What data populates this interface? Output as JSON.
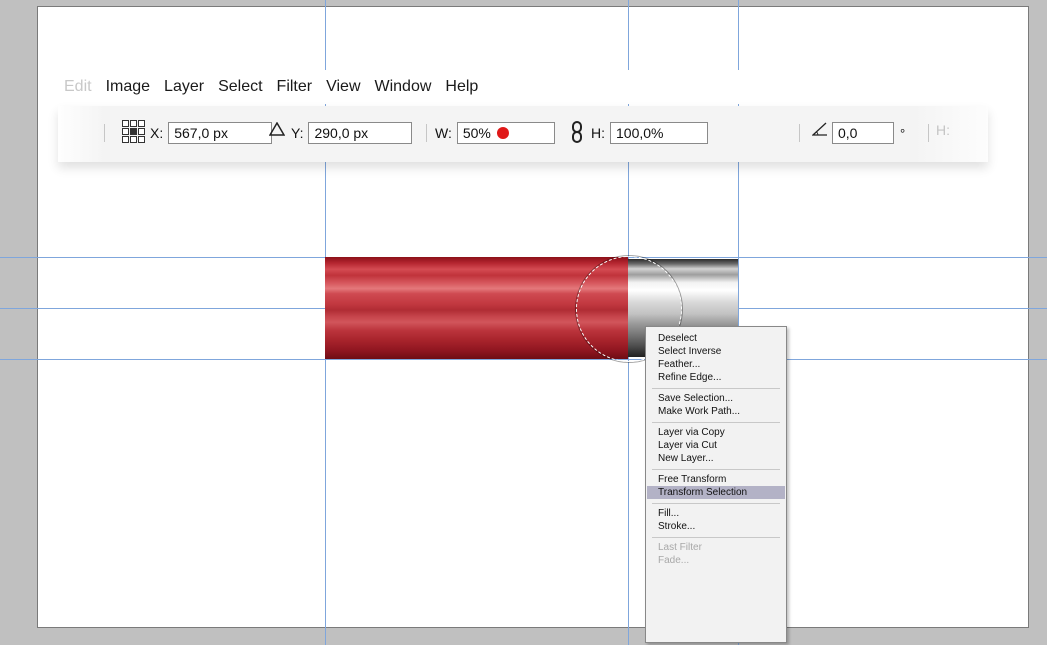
{
  "menubar": {
    "items": [
      "Edit",
      "Image",
      "Layer",
      "Select",
      "Filter",
      "View",
      "Window",
      "Help"
    ]
  },
  "options": {
    "x_label": "X:",
    "x_value": "567,0 px",
    "delta_icon": "triangle-icon",
    "y_label": "Y:",
    "y_value": "290,0 px",
    "w_label": "W:",
    "w_value": "50%",
    "link_icon": "chain-link-icon",
    "h_label": "H:",
    "h_value": "100,0%",
    "angle_icon": "angle-icon",
    "angle_value": "0,0",
    "degree_symbol": "°",
    "h_skew_label": "H:"
  },
  "context_menu": {
    "groups": [
      [
        {
          "label": "Deselect"
        },
        {
          "label": "Select Inverse"
        },
        {
          "label": "Feather..."
        },
        {
          "label": "Refine Edge..."
        }
      ],
      [
        {
          "label": "Save Selection..."
        },
        {
          "label": "Make Work Path..."
        }
      ],
      [
        {
          "label": "Layer via Copy"
        },
        {
          "label": "Layer via Cut"
        },
        {
          "label": "New Layer..."
        }
      ],
      [
        {
          "label": "Free Transform"
        },
        {
          "label": "Transform Selection",
          "highlighted": true
        }
      ],
      [
        {
          "label": "Fill..."
        },
        {
          "label": "Stroke..."
        }
      ],
      [
        {
          "label": "Last Filter",
          "disabled": true
        },
        {
          "label": "Fade...",
          "disabled": true
        }
      ]
    ]
  },
  "colors": {
    "guide": "#7fa6dc",
    "red_pipe": "#c0333b",
    "highlight": "#b3b2c6",
    "red_dot": "#e01818"
  }
}
